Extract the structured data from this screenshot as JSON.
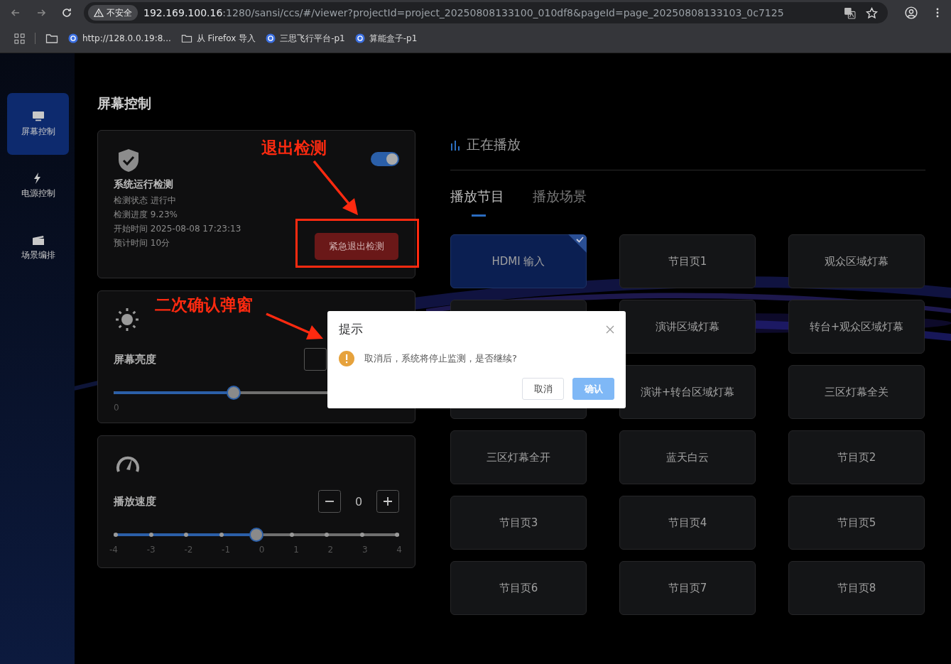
{
  "browser": {
    "security_label": "不安全",
    "url_host": "192.169.100.16",
    "url_rest": ":1280/sansi/ccs/#/viewer?projectId=project_20250808133100_010df8&pageId=page_20250808133103_0c7125",
    "bookmarks": [
      {
        "kind": "site",
        "label": "http://128.0.0.19:8..."
      },
      {
        "kind": "folder",
        "label": "从 Firefox 导入"
      },
      {
        "kind": "site",
        "label": "三思飞行平台-p1"
      },
      {
        "kind": "site",
        "label": "算能盒子-p1"
      }
    ]
  },
  "sidebar": {
    "items": [
      {
        "label": "屏幕控制",
        "selected": true
      },
      {
        "label": "电源控制",
        "selected": false
      },
      {
        "label": "场景编排",
        "selected": false
      }
    ]
  },
  "page_title": "屏幕控制",
  "detection": {
    "title": "系统运行检测",
    "on": true,
    "lines": [
      "检测状态 进行中",
      "检测进度 9.23%",
      "开始时间 2025-08-08 17:23:13",
      "预计时间 10分"
    ],
    "exit_button": "紧急退出检测"
  },
  "brightness": {
    "label": "屏幕亮度",
    "level": 0.42,
    "min_label": "0"
  },
  "speed": {
    "label": "播放速度",
    "value": "0",
    "level": 0.5,
    "ticks": [
      "-4",
      "-3",
      "-2",
      "-1",
      "0",
      "1",
      "2",
      "3",
      "4"
    ]
  },
  "playing": {
    "title": "正在播放",
    "tabs": [
      {
        "label": "播放节目",
        "selected": true
      },
      {
        "label": "播放场景",
        "selected": false
      }
    ],
    "items": [
      {
        "label": "HDMI 输入",
        "selected": true
      },
      {
        "label": "节目页1",
        "selected": false
      },
      {
        "label": "观众区域灯幕",
        "selected": false
      },
      {
        "selected": false
      },
      {
        "label": "演讲区域灯幕",
        "selected": false
      },
      {
        "label": "转台+观众区域灯幕",
        "selected": false
      },
      {
        "selected": false
      },
      {
        "label": "演讲+转台区域灯幕",
        "selected": false
      },
      {
        "label": "三区灯幕全关",
        "selected": false
      },
      {
        "label": "三区灯幕全开",
        "selected": false
      },
      {
        "label": "蓝天白云",
        "selected": false
      },
      {
        "label": "节目页2",
        "selected": false
      },
      {
        "label": "节目页3",
        "selected": false
      },
      {
        "label": "节目页4",
        "selected": false
      },
      {
        "label": "节目页5",
        "selected": false
      },
      {
        "label": "节目页6",
        "selected": false
      },
      {
        "label": "节目页7",
        "selected": false
      },
      {
        "label": "节目页8",
        "selected": false
      }
    ]
  },
  "dialog": {
    "title": "提示",
    "message": "取消后，系统将停止监测，是否继续?",
    "cancel": "取消",
    "confirm": "确认"
  },
  "annotations": [
    {
      "kind": "exit",
      "text": "退出检测"
    },
    {
      "kind": "dialog",
      "text": "二次确认弹窗"
    }
  ]
}
